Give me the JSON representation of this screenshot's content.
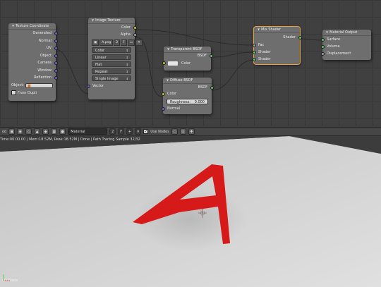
{
  "node_editor": {
    "texture_coordinate": {
      "title": "Texture Coordinate",
      "outputs": [
        "Generated",
        "Normal",
        "UV",
        "Object",
        "Camera",
        "Window",
        "Reflection"
      ],
      "object_label": "Object:",
      "from_dupli": "From Dupli"
    },
    "image_texture": {
      "title": "Image Texture",
      "outputs": [
        "Color",
        "Alpha"
      ],
      "image_name": "A.png",
      "image_users": "2",
      "image_fake": "F",
      "color_space": "Color",
      "interpolation": "Linear",
      "projection": "Flat",
      "extension": "Repeat",
      "source": "Single Image",
      "input": "Vector"
    },
    "transparent_bsdf": {
      "title": "Transparent BSDF",
      "output": "BSDF",
      "input": "Color"
    },
    "diffuse_bsdf": {
      "title": "Diffuse BSDF",
      "output": "BSDF",
      "color": "Color",
      "roughness_label": "Roughness:",
      "roughness_value": "0.000",
      "normal": "Normal"
    },
    "mix_shader": {
      "title": "Mix Shader",
      "output": "Shader",
      "inputs": [
        "Fac",
        "Shader",
        "Shader"
      ]
    },
    "material_output": {
      "title": "Material Output",
      "inputs": [
        "Surface",
        "Volume",
        "Displacement"
      ]
    }
  },
  "nodes_header": {
    "material_name": "Material",
    "users_count": "2",
    "use_nodes_label": "Use Nodes",
    "fake_label": "F"
  },
  "viewport": {
    "status": "Time:00:00.00 | Mem:18.52M, Peak:18.52M | Done | Path Tracing Sample 32/32",
    "object_label": "(1) Plane"
  },
  "colors": {
    "letter": "#d61a1a",
    "socket_color": "#c7c729",
    "socket_shader": "#63c763",
    "socket_vector": "#6363c7",
    "socket_float": "#a1a1a1",
    "active_outline": "#e8a33a"
  },
  "icons": [
    "triangle-collapse-icon",
    "checkbox-icon",
    "object-cube-icon",
    "node-tree-icon",
    "close-icon",
    "camera-icon",
    "render-icon",
    "pin-icon",
    "crosshair-icon",
    "axis-gizmo-icon"
  ]
}
